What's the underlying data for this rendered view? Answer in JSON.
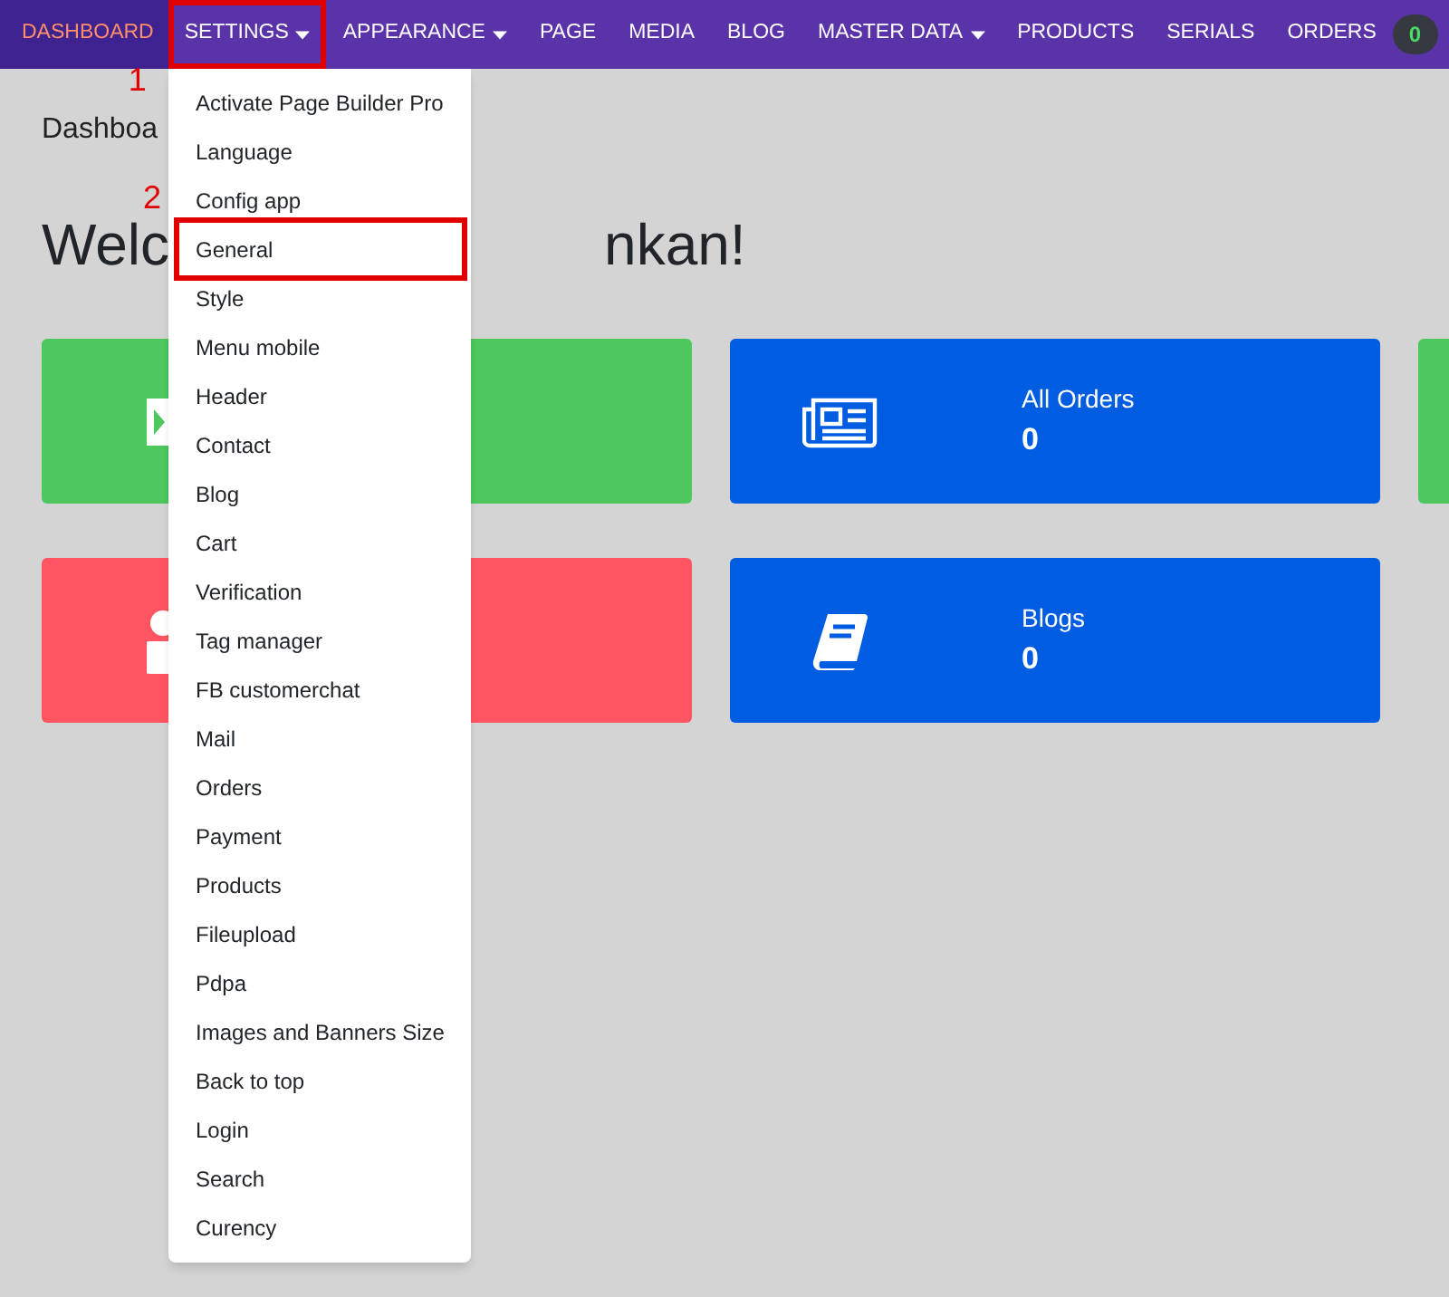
{
  "nav": {
    "items": [
      {
        "label": "DASHBOARD",
        "kind": "brand",
        "dropdown": false,
        "highlighted": false
      },
      {
        "label": "SETTINGS",
        "kind": "link",
        "dropdown": true,
        "highlighted": true,
        "marker": "1"
      },
      {
        "label": "APPEARANCE",
        "kind": "link",
        "dropdown": true,
        "highlighted": false
      },
      {
        "label": "PAGE",
        "kind": "link",
        "dropdown": false,
        "highlighted": false
      },
      {
        "label": "MEDIA",
        "kind": "link",
        "dropdown": false,
        "highlighted": false
      },
      {
        "label": "BLOG",
        "kind": "link",
        "dropdown": false,
        "highlighted": false
      },
      {
        "label": "MASTER DATA",
        "kind": "link",
        "dropdown": true,
        "highlighted": false
      },
      {
        "label": "PRODUCTS",
        "kind": "link",
        "dropdown": false,
        "highlighted": false
      },
      {
        "label": "SERIALS",
        "kind": "link",
        "dropdown": false,
        "highlighted": false
      },
      {
        "label": "ORDERS",
        "kind": "link",
        "dropdown": false,
        "highlighted": false,
        "badge": "0"
      }
    ]
  },
  "settings_menu": {
    "items": [
      {
        "label": "Activate Page Builder Pro",
        "highlighted": false
      },
      {
        "label": "Language",
        "highlighted": false
      },
      {
        "label": "Config app",
        "highlighted": false
      },
      {
        "label": "General",
        "highlighted": true,
        "marker": "2"
      },
      {
        "label": "Style",
        "highlighted": false
      },
      {
        "label": "Menu mobile",
        "highlighted": false
      },
      {
        "label": "Header",
        "highlighted": false
      },
      {
        "label": "Contact",
        "highlighted": false
      },
      {
        "label": "Blog",
        "highlighted": false
      },
      {
        "label": "Cart",
        "highlighted": false
      },
      {
        "label": "Verification",
        "highlighted": false
      },
      {
        "label": "Tag manager",
        "highlighted": false
      },
      {
        "label": "FB customerchat",
        "highlighted": false
      },
      {
        "label": "Mail",
        "highlighted": false
      },
      {
        "label": "Orders",
        "highlighted": false
      },
      {
        "label": "Payment",
        "highlighted": false
      },
      {
        "label": "Products",
        "highlighted": false
      },
      {
        "label": "Fileupload",
        "highlighted": false
      },
      {
        "label": "Pdpa",
        "highlighted": false
      },
      {
        "label": "Images and Banners Size",
        "highlighted": false
      },
      {
        "label": "Back to top",
        "highlighted": false
      },
      {
        "label": "Login",
        "highlighted": false
      },
      {
        "label": "Search",
        "highlighted": false
      },
      {
        "label": "Curency",
        "highlighted": false
      }
    ]
  },
  "breadcrumb": "Dashboa",
  "welcome": {
    "start": "Welc",
    "end": "nkan!"
  },
  "cards": [
    [
      {
        "color": "#4cc85c",
        "kind": "partial"
      },
      {
        "color": "#005ce0",
        "kind": "newspaper",
        "title": "All Orders",
        "value": "0"
      },
      {
        "color": "#4cc85c",
        "kind": "none"
      }
    ],
    [
      {
        "color": "#ff5563",
        "kind": "partial-user"
      },
      {
        "color": "#005ce0",
        "kind": "book",
        "title": "Blogs",
        "value": "0"
      }
    ]
  ]
}
